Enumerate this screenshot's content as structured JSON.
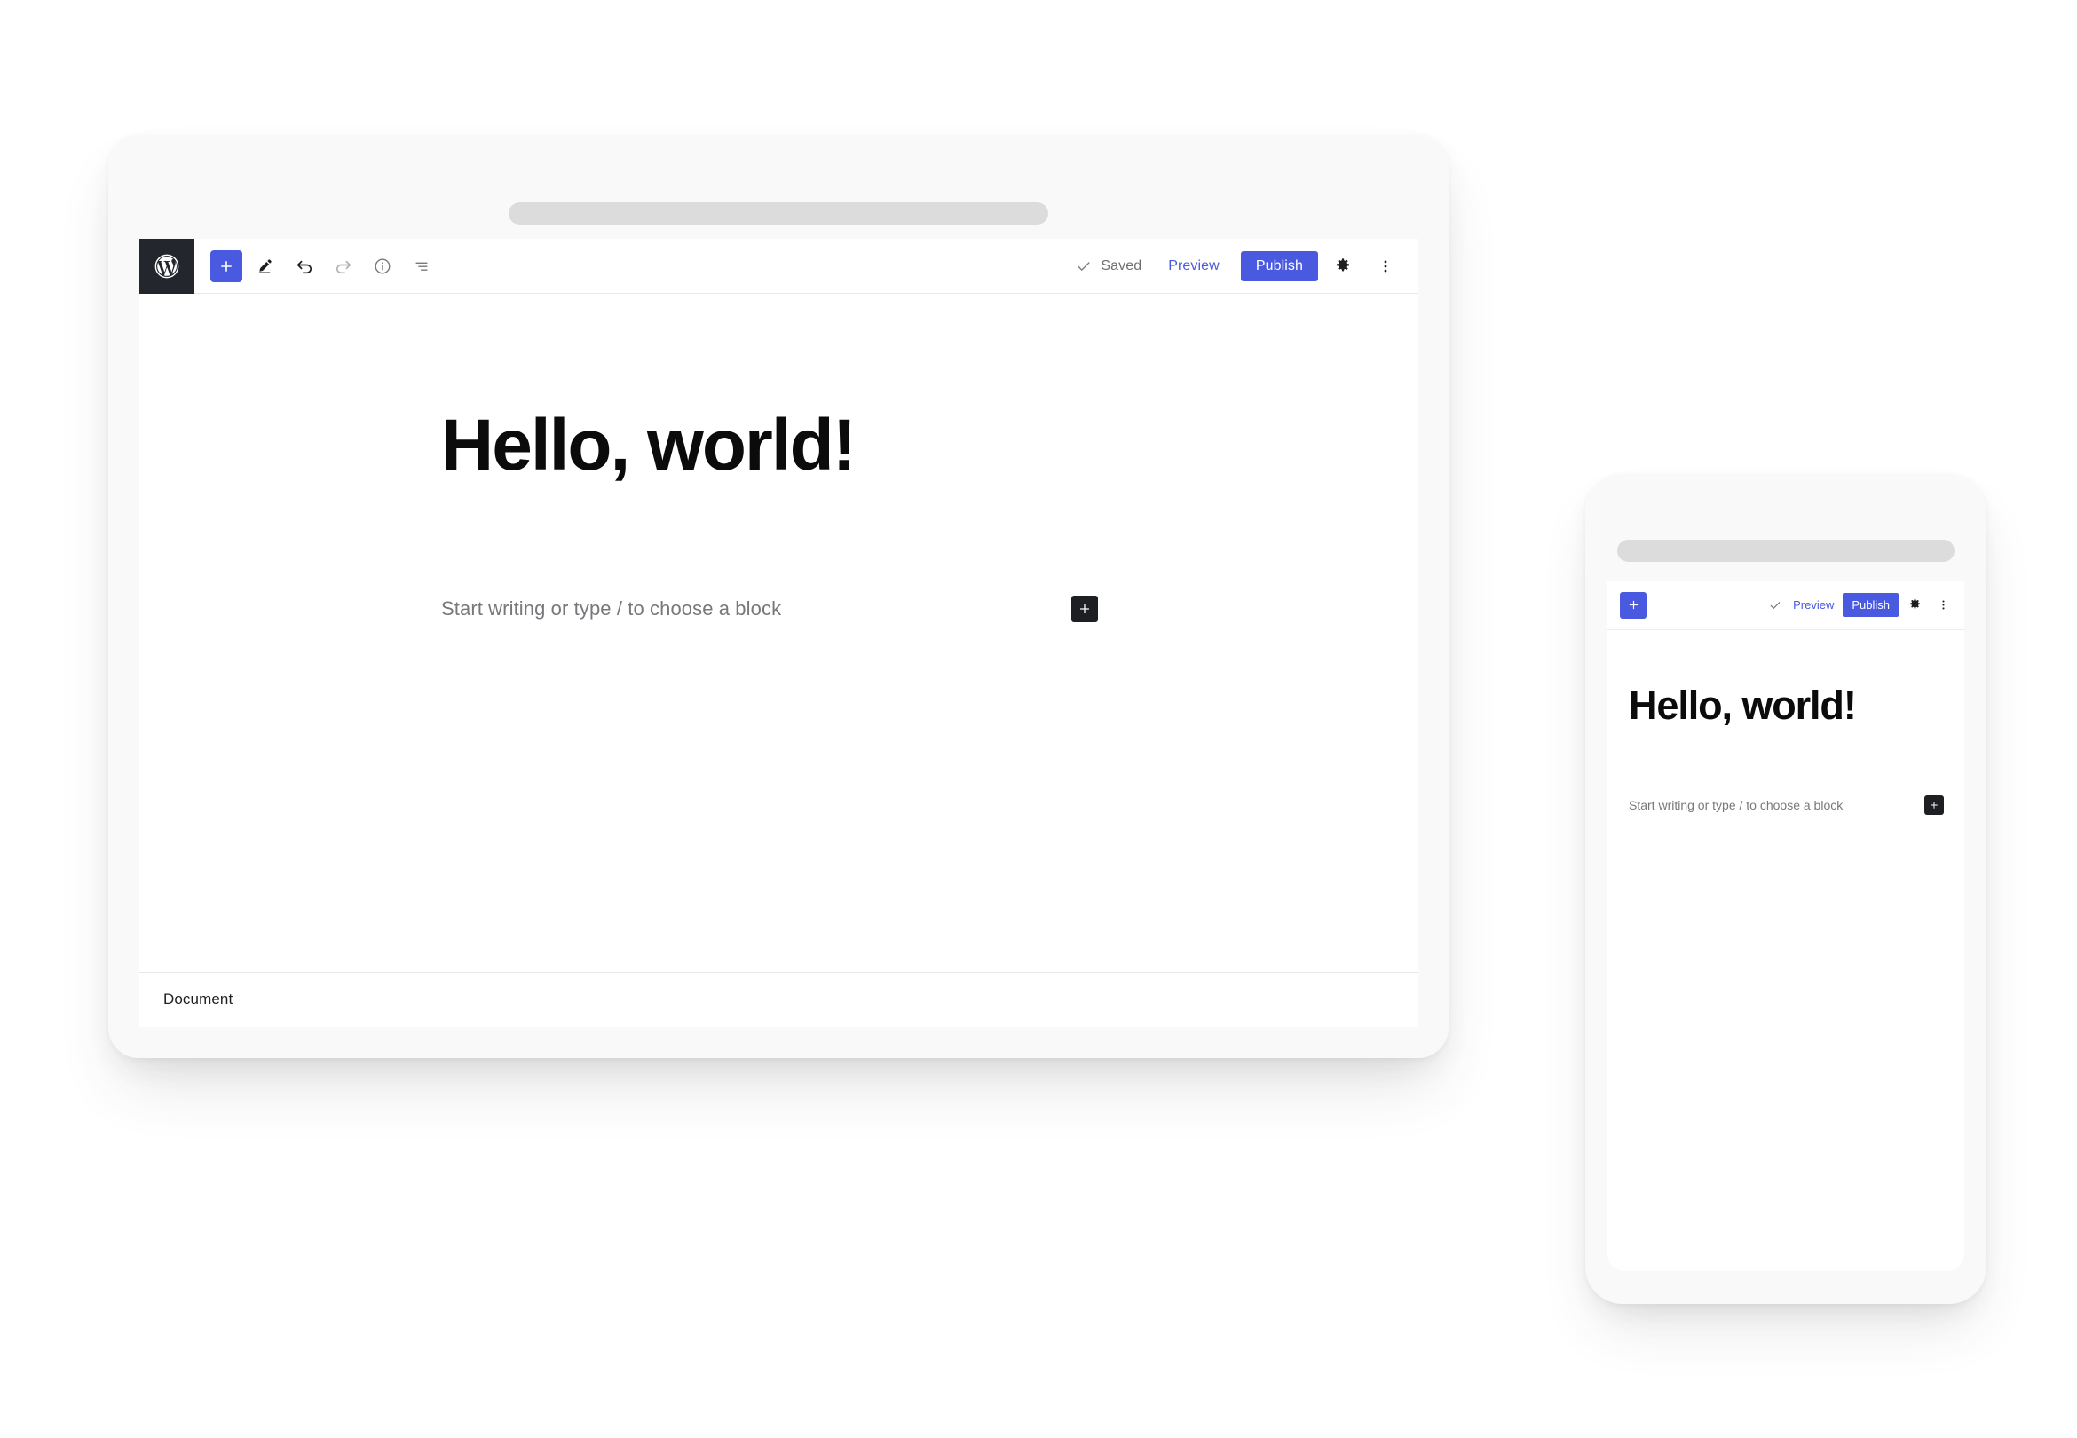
{
  "colors": {
    "accent_blue": "#4a5ae0",
    "logo_tile_dark": "#24262e",
    "inserter_dark": "#1d1f22",
    "device_frame": "#f9f9fa",
    "pill_gray": "#dcdcdd",
    "placeholder_text": "#77787b",
    "page_background": "#ffffff"
  },
  "desktop": {
    "device_name": "tablet-laptop-device",
    "header": {
      "logo_icon": "wordpress-logo-icon",
      "add_block_icon": "plus-icon",
      "tools": [
        {
          "icon": "pencil-edit-icon",
          "name": "edit-tool",
          "disabled": false
        },
        {
          "icon": "undo-arrow-icon",
          "name": "undo-button",
          "disabled": false
        },
        {
          "icon": "redo-arrow-icon",
          "name": "redo-button",
          "disabled": true
        },
        {
          "icon": "info-circle-icon",
          "name": "details-button",
          "disabled": false
        },
        {
          "icon": "list-view-icon",
          "name": "list-view-button",
          "disabled": false
        }
      ],
      "saved_icon": "checkmark-icon",
      "saved_label": "Saved",
      "preview_label": "Preview",
      "publish_label": "Publish",
      "settings_icon": "gear-icon",
      "more_icon": "three-dots-vertical-icon"
    },
    "canvas": {
      "post_title": "Hello, world!",
      "paragraph_placeholder": "Start writing or type / to choose a block",
      "inline_inserter_icon": "plus-icon"
    },
    "footer": {
      "breadcrumb_label": "Document"
    }
  },
  "mobile": {
    "device_name": "phone-device",
    "header": {
      "add_block_icon": "plus-icon",
      "saved_icon": "checkmark-icon",
      "preview_label": "Preview",
      "publish_label": "Publish",
      "settings_icon": "gear-icon",
      "more_icon": "three-dots-vertical-icon"
    },
    "canvas": {
      "post_title": "Hello, world!",
      "paragraph_placeholder": "Start writing or type / to choose a block",
      "inline_inserter_icon": "plus-icon"
    }
  }
}
